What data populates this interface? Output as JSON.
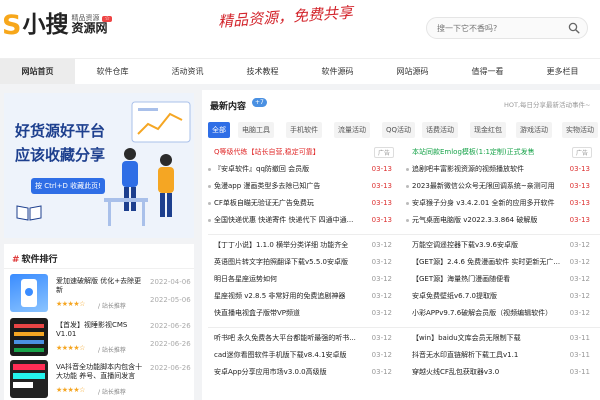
{
  "logo": {
    "s": "S",
    "cn": "小搜",
    "sub_top": "精品资源",
    "badge": "☆",
    "sub_bot": "资源网"
  },
  "slogan": "精品资源，免费共享",
  "search": {
    "placeholder": "搜一下它不香吗?"
  },
  "nav": [
    "网站首页",
    "软件仓库",
    "活动资讯",
    "技术教程",
    "软件源码",
    "网站源码",
    "值得一看",
    "更多栏目"
  ],
  "banner": {
    "line1": "好货源好平台",
    "line2": "应该收藏分享",
    "button": "按 Ctrl+D 收藏此页!"
  },
  "rank": {
    "title": "软件排行",
    "items": [
      {
        "title": "爱加速破解版 优化+去除更新",
        "date": "2022-04-06",
        "stars": "★★★★☆",
        "meta": "/ 站长推荐",
        "time": "2022-05-06"
      },
      {
        "title": "【首发】视睡影视CMS V1.01",
        "date": "2022-06-26",
        "stars": "★★★★☆",
        "meta": "/ 站长推荐",
        "time": "2022-06-26"
      },
      {
        "title": "VA抖音全功能脚本内包含十大功能 养号、直播间发言",
        "date": "2022-06-26",
        "stars": "★★★★☆",
        "meta": "/ 站长推荐",
        "time": ""
      }
    ]
  },
  "latest": {
    "title": "最新内容",
    "badge": "+7",
    "note": "HOT,每日分享最新活动事件~"
  },
  "tabs": [
    "全部",
    "电脑工具",
    "手机软件",
    "流量活动",
    "QQ活动",
    "话费活动",
    "现金红包",
    "游戏活动",
    "实物活动"
  ],
  "left_col": [
    {
      "text": "Q等级代练【站长自营,稳定可靠】",
      "date": "广告",
      "type": "ad-red"
    },
    {
      "text": "『安卓软件』qq防撤回 会员版",
      "date": "03-13"
    },
    {
      "text": "免漫app 漫画类型多去除已知广告",
      "date": "03-13"
    },
    {
      "text": "CF单板自瞄无验证无广告免费玩",
      "date": "03-13"
    },
    {
      "text": "全国快递优惠 快递寄件 快递代下 四通中通...",
      "date": "03-13"
    },
    {
      "text": "【丁丁小说】1.1.0 横举分类详细 功能齐全",
      "date": "03-12",
      "grey": true
    },
    {
      "text": "英语图片转文字拍照翻译下载v5.5.0安卓版",
      "date": "03-12",
      "grey": true
    },
    {
      "text": "明日各星座运势如何",
      "date": "03-12",
      "grey": true
    },
    {
      "text": "星座视频 v2.8.5 非常好用的免费追剧神器",
      "date": "03-12",
      "grey": true
    },
    {
      "text": "快直播电视盒子版带VP频道",
      "date": "03-12",
      "grey": true
    },
    {
      "text": "听书吧 永久免费各大平台都能听最强的听书...",
      "date": "03-12",
      "grey": true
    },
    {
      "text": "cad迷你看图软件手机版下载v8.4.1安卓版",
      "date": "03-12",
      "grey": true
    },
    {
      "text": "安卓App分享应用市场v3.0.0高级版",
      "date": "03-12",
      "grey": true
    }
  ],
  "right_col": [
    {
      "text": "本站同款Emlog模板(1:1定制)正式发售",
      "date": "广告",
      "type": "ad-green"
    },
    {
      "text": "追剧吧丰富影视资源的视频播放软件",
      "date": "03-13"
    },
    {
      "text": "2023最新微信公众号无限回调系统~亲测可用",
      "date": "03-13"
    },
    {
      "text": "安卓猴子分身 v3.4.2.01 全新的应用多开软件",
      "date": "03-13"
    },
    {
      "text": "元气桌面电脑版 v2022.3.3.864 破解版",
      "date": "03-13"
    },
    {
      "text": "万能空调遥控器下载v3.9.6安卓版",
      "date": "03-12",
      "grey": true
    },
    {
      "text": "【GET源】2.4.6 免费漫画软件 实时更新无广...",
      "date": "03-12",
      "grey": true
    },
    {
      "text": "【GET源】海量热门漫画随便看",
      "date": "03-12",
      "grey": true
    },
    {
      "text": "安卓免费壁纸v6.7.0提取版",
      "date": "03-12",
      "grey": true
    },
    {
      "text": "小彩APPv9.7.6破解会员版（视频编辑软件）",
      "date": "03-12",
      "grey": true
    },
    {
      "text": "【win】baidu文库会员无限制下载",
      "date": "03-11",
      "grey": true
    },
    {
      "text": "抖音无水印直链解析下载工具v1.1",
      "date": "03-11",
      "grey": true
    },
    {
      "text": "穿越火线CF乱包获取器v3.0",
      "date": "03-11",
      "grey": true
    }
  ]
}
